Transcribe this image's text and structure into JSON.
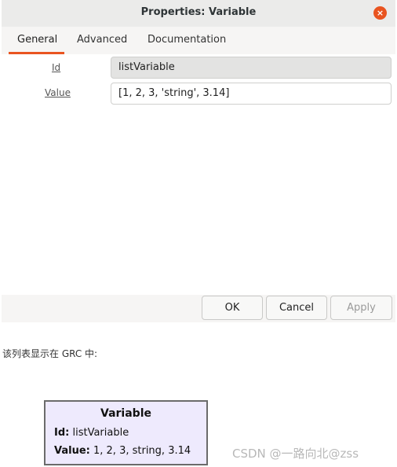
{
  "dialog": {
    "title": "Properties: Variable",
    "close_glyph": "×",
    "tabs": [
      {
        "label": "General"
      },
      {
        "label": "Advanced"
      },
      {
        "label": "Documentation"
      }
    ],
    "fields": [
      {
        "label": "Id",
        "value": "listVariable",
        "editable": false
      },
      {
        "label": "Value",
        "value": "[1, 2, 3, 'string', 3.14]",
        "editable": true
      }
    ],
    "buttons": {
      "ok": "OK",
      "cancel": "Cancel",
      "apply": "Apply"
    }
  },
  "caption": "该列表显示在 GRC 中:",
  "block": {
    "title": "Variable",
    "id_label": "Id:",
    "id_value": "listVariable",
    "value_label": "Value:",
    "value_value": "1, 2, 3, string, 3.14"
  },
  "watermark": "CSDN @一路向北@zss",
  "colors": {
    "accent": "#e95420",
    "block_bg": "#eeeafd"
  }
}
